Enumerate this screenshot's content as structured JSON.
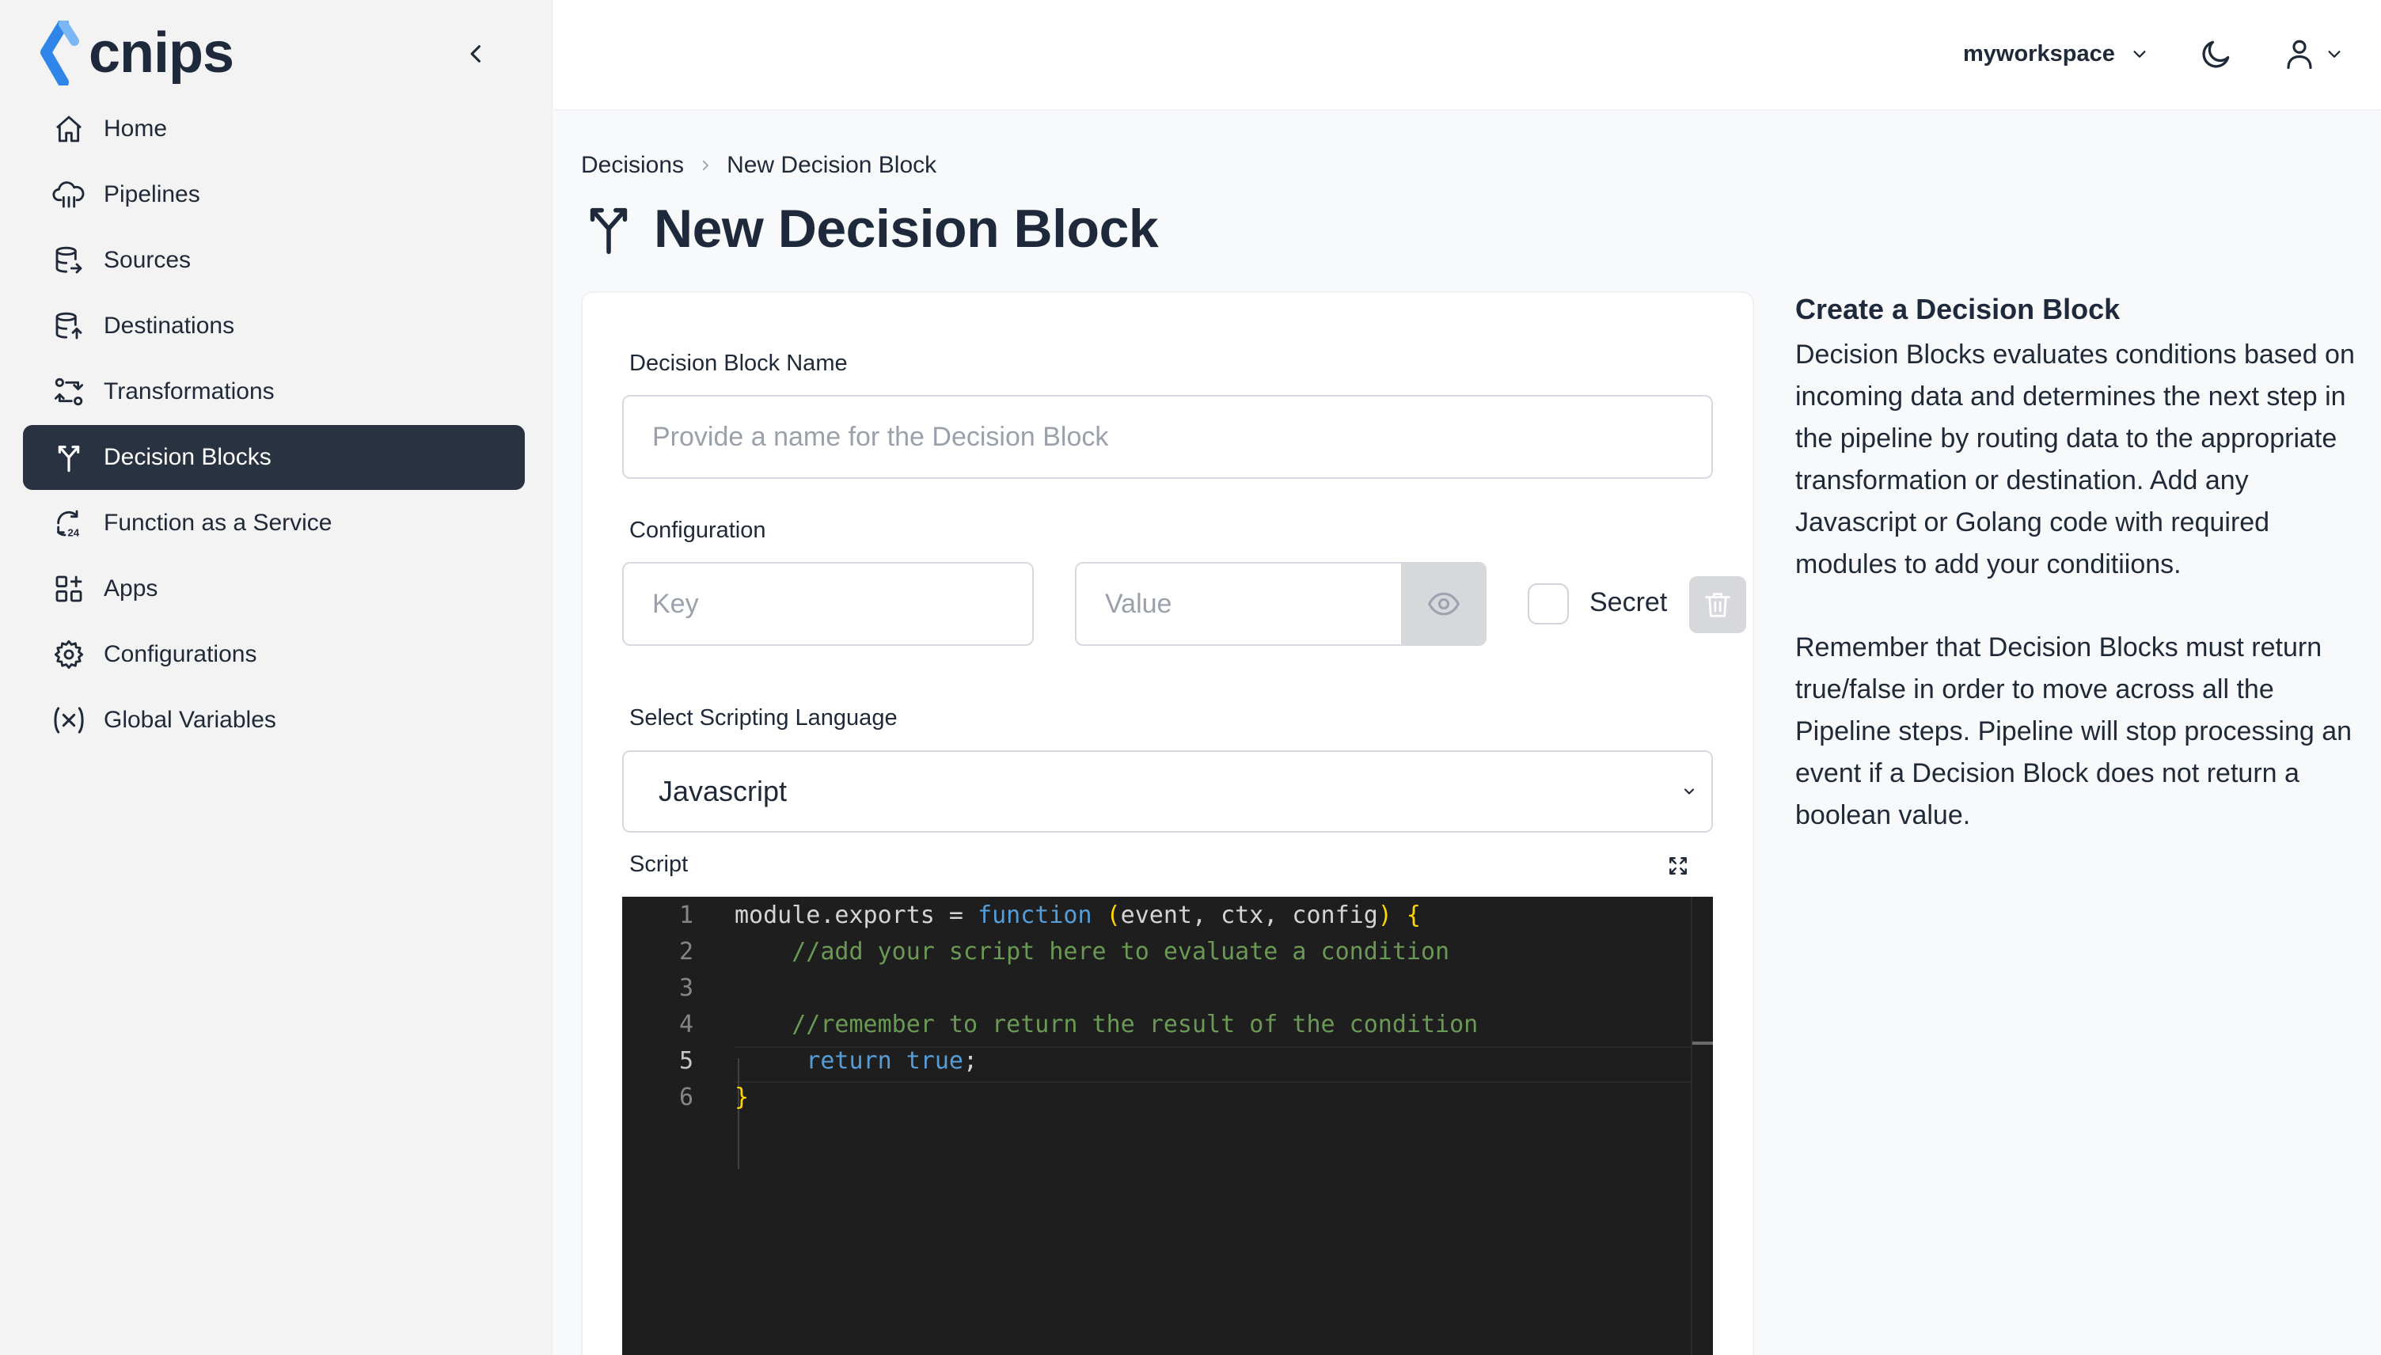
{
  "app": {
    "logo_text": "cnips"
  },
  "sidebar": {
    "items": [
      {
        "label": "Home",
        "icon": "home-icon"
      },
      {
        "label": "Pipelines",
        "icon": "cloud-icon"
      },
      {
        "label": "Sources",
        "icon": "database-out-icon"
      },
      {
        "label": "Destinations",
        "icon": "database-in-icon"
      },
      {
        "label": "Transformations",
        "icon": "transform-icon"
      },
      {
        "label": "Decision Blocks",
        "icon": "decision-fork-icon",
        "active": true
      },
      {
        "label": "Function as a Service",
        "icon": "faas-icon"
      },
      {
        "label": "Apps",
        "icon": "apps-icon"
      },
      {
        "label": "Configurations",
        "icon": "gear-icon"
      },
      {
        "label": "Global Variables",
        "icon": "variable-icon"
      }
    ]
  },
  "topbar": {
    "workspace": "myworkspace"
  },
  "breadcrumb": {
    "parent": "Decisions",
    "current": "New Decision Block"
  },
  "page": {
    "title": "New Decision Block"
  },
  "form": {
    "name_label": "Decision Block Name",
    "name_placeholder": "Provide a name for the Decision Block",
    "config_label": "Configuration",
    "key_placeholder": "Key",
    "value_placeholder": "Value",
    "secret_label": "Secret",
    "lang_label": "Select Scripting Language",
    "lang_value": "Javascript",
    "script_label": "Script"
  },
  "editor": {
    "line_numbers": [
      "1",
      "2",
      "3",
      "4",
      "5",
      "6"
    ],
    "current_line": 5,
    "lines": [
      "module.exports = function (event, ctx, config) {",
      "    //add your script here to evaluate a condition",
      "",
      "    //remember to return the result of the condition",
      "    return true;",
      "}"
    ]
  },
  "help": {
    "title": "Create a Decision Block",
    "paragraph1": "Decision Blocks evaluates conditions based on incoming data and determines the next step in the pipeline by routing data to the appropriate transformation or destination. Add any Javascript or Golang code with required modules to add your conditiions.",
    "paragraph2": "Remember that Decision Blocks must return true/false in order to move across all the Pipeline steps. Pipeline will stop processing an event if a Decision Block does not return a boolean value."
  },
  "colors": {
    "sidebar_active_bg": "#283241",
    "editor_bg": "#1e1e1e",
    "keyword": "#569cd6",
    "comment": "#6a9955",
    "bracket": "#ffd700"
  }
}
